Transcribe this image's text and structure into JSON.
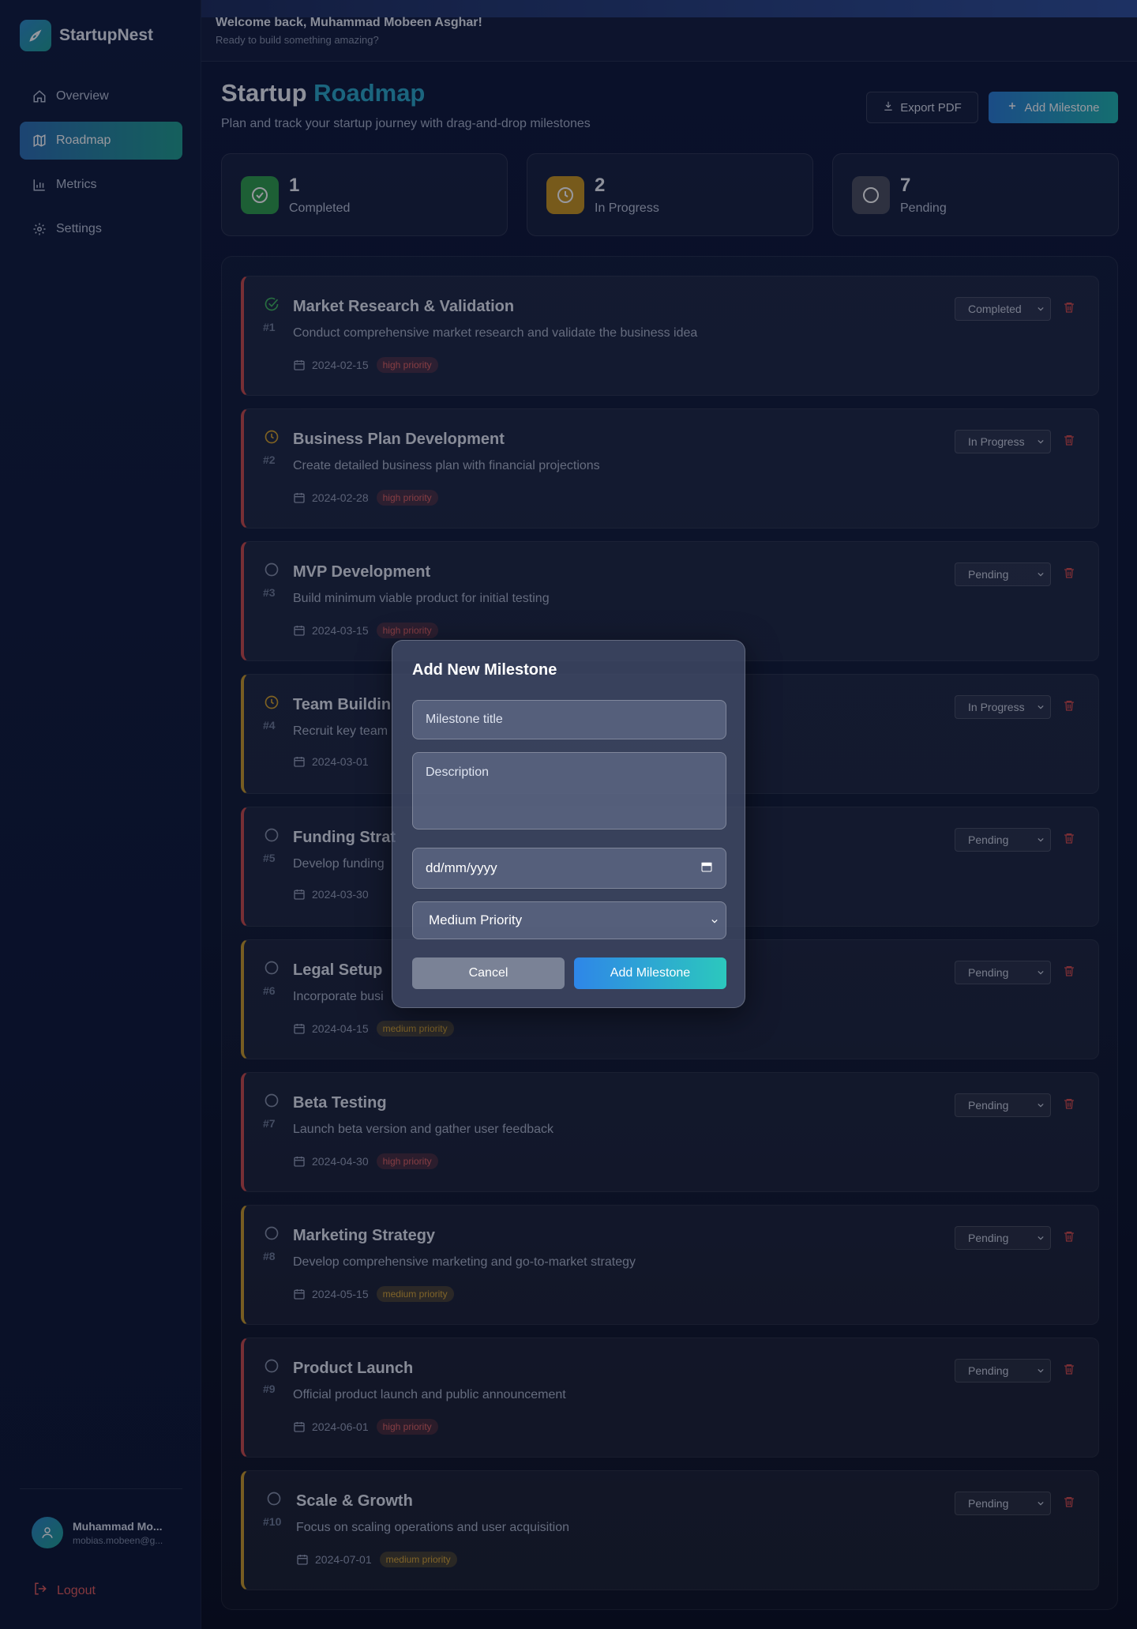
{
  "app": {
    "name": "StartupNest"
  },
  "sidebar": {
    "items": [
      {
        "label": "Overview",
        "icon": "home-icon"
      },
      {
        "label": "Roadmap",
        "icon": "map-icon",
        "active": true
      },
      {
        "label": "Metrics",
        "icon": "bar-chart-icon"
      },
      {
        "label": "Settings",
        "icon": "gear-icon"
      }
    ],
    "user": {
      "name": "Muhammad Mo...",
      "email": "mobias.mobeen@g..."
    },
    "logout_label": "Logout"
  },
  "topbar": {
    "welcome": "Welcome back, Muhammad Mobeen Asghar!",
    "subtitle": "Ready to build something amazing?"
  },
  "header": {
    "title_main": "Startup ",
    "title_accent": "Roadmap",
    "subtitle": "Plan and track your startup journey with drag-and-drop milestones",
    "export_label": "Export PDF",
    "add_label": "Add Milestone"
  },
  "stats": [
    {
      "value": "1",
      "label": "Completed",
      "color": "#2e9e4a"
    },
    {
      "value": "2",
      "label": "In Progress",
      "color": "#c9951e"
    },
    {
      "value": "7",
      "label": "Pending",
      "color": "#4a4f5e"
    }
  ],
  "milestones": [
    {
      "num": "#1",
      "title": "Market Research & Validation",
      "desc": "Conduct comprehensive market research and validate the business idea",
      "date": "2024-02-15",
      "priority": "high priority",
      "status": "Completed"
    },
    {
      "num": "#2",
      "title": "Business Plan Development",
      "desc": "Create detailed business plan with financial projections",
      "date": "2024-02-28",
      "priority": "high priority",
      "status": "In Progress"
    },
    {
      "num": "#3",
      "title": "MVP Development",
      "desc": "Build minimum viable product for initial testing",
      "date": "2024-03-15",
      "priority": "high priority",
      "status": "Pending"
    },
    {
      "num": "#4",
      "title": "Team Buildin",
      "desc": "Recruit key team",
      "date": "2024-03-01",
      "priority": "",
      "status": "In Progress"
    },
    {
      "num": "#5",
      "title": "Funding Strat",
      "desc": "Develop funding",
      "date": "2024-03-30",
      "priority": "",
      "status": "Pending"
    },
    {
      "num": "#6",
      "title": "Legal Setup",
      "desc": "Incorporate busi",
      "date": "2024-04-15",
      "priority": "medium priority",
      "status": "Pending"
    },
    {
      "num": "#7",
      "title": "Beta Testing",
      "desc": "Launch beta version and gather user feedback",
      "date": "2024-04-30",
      "priority": "high priority",
      "status": "Pending"
    },
    {
      "num": "#8",
      "title": "Marketing Strategy",
      "desc": "Develop comprehensive marketing and go-to-market strategy",
      "date": "2024-05-15",
      "priority": "medium priority",
      "status": "Pending"
    },
    {
      "num": "#9",
      "title": "Product Launch",
      "desc": "Official product launch and public announcement",
      "date": "2024-06-01",
      "priority": "high priority",
      "status": "Pending"
    },
    {
      "num": "#10",
      "title": "Scale & Growth",
      "desc": "Focus on scaling operations and user acquisition",
      "date": "2024-07-01",
      "priority": "medium priority",
      "status": "Pending"
    }
  ],
  "modal": {
    "title": "Add New Milestone",
    "title_placeholder": "Milestone title",
    "desc_placeholder": "Description",
    "date_placeholder": "dd/mm/yyyy",
    "priority_value": "Medium Priority",
    "cancel_label": "Cancel",
    "add_label": "Add Milestone"
  },
  "colors": {
    "high": "#c94b4b",
    "medium": "#c99a2a",
    "accent": "#2aa8c9",
    "completed": "#2e9e4a",
    "in_progress": "#c9951e"
  }
}
